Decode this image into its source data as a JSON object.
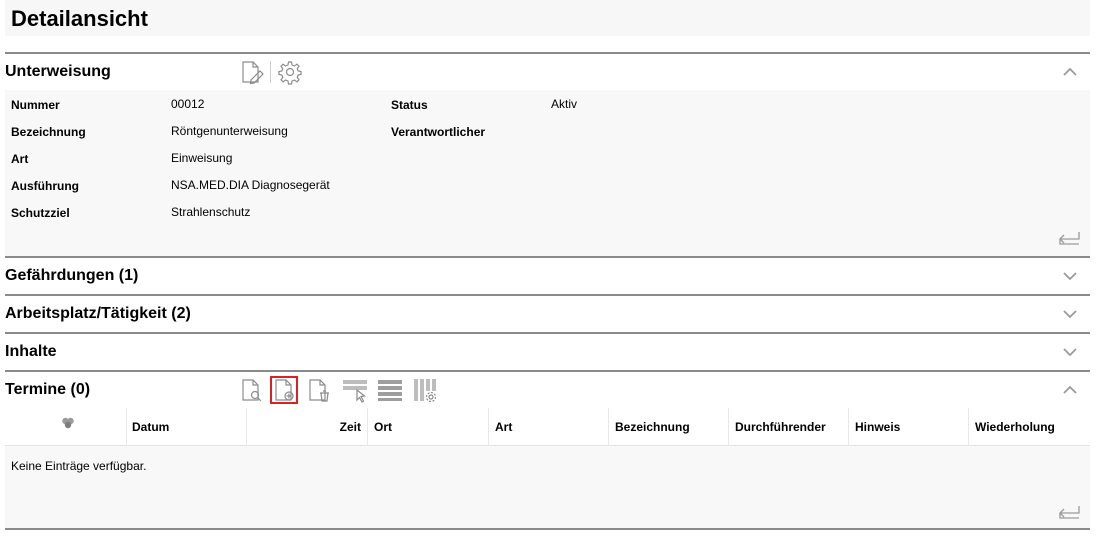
{
  "page": {
    "title": "Detailansicht"
  },
  "unterweisung": {
    "title": "Unterweisung",
    "fields": {
      "nummer": {
        "label": "Nummer",
        "value": "00012"
      },
      "status": {
        "label": "Status",
        "value": "Aktiv"
      },
      "bezeichnung": {
        "label": "Bezeichnung",
        "value": "Röntgenunterweisung"
      },
      "verantwortlicher": {
        "label": "Verantwortlicher",
        "value": ""
      },
      "art": {
        "label": "Art",
        "value": "Einweisung"
      },
      "ausfuehrung": {
        "label": "Ausführung",
        "value": "NSA.MED.DIA Diagnosegerät"
      },
      "schutzziel": {
        "label": "Schutzziel",
        "value": "Strahlenschutz"
      }
    },
    "icons": [
      "edit-document-icon",
      "gear-icon",
      "chevron-up-icon",
      "return-arrow-icon"
    ]
  },
  "sections": {
    "gefaehrdungen": {
      "title": "Gefährdungen (1)"
    },
    "arbeitsplatz": {
      "title": "Arbeitsplatz/Tätigkeit (2)"
    },
    "inhalte": {
      "title": "Inhalte"
    }
  },
  "termine": {
    "title": "Termine (0)",
    "toolbar_icons": [
      "search-document-icon",
      "add-document-icon",
      "delete-document-icon",
      "filter-rows-icon",
      "list-view-icon",
      "column-settings-icon"
    ],
    "selected_tool": "add-document-icon",
    "columns": [
      "Datum",
      "Zeit",
      "Ort",
      "Art",
      "Bezeichnung",
      "Durchführender",
      "Hinweis",
      "Wiederholung"
    ],
    "empty_message": "Keine Einträge verfügbar."
  }
}
